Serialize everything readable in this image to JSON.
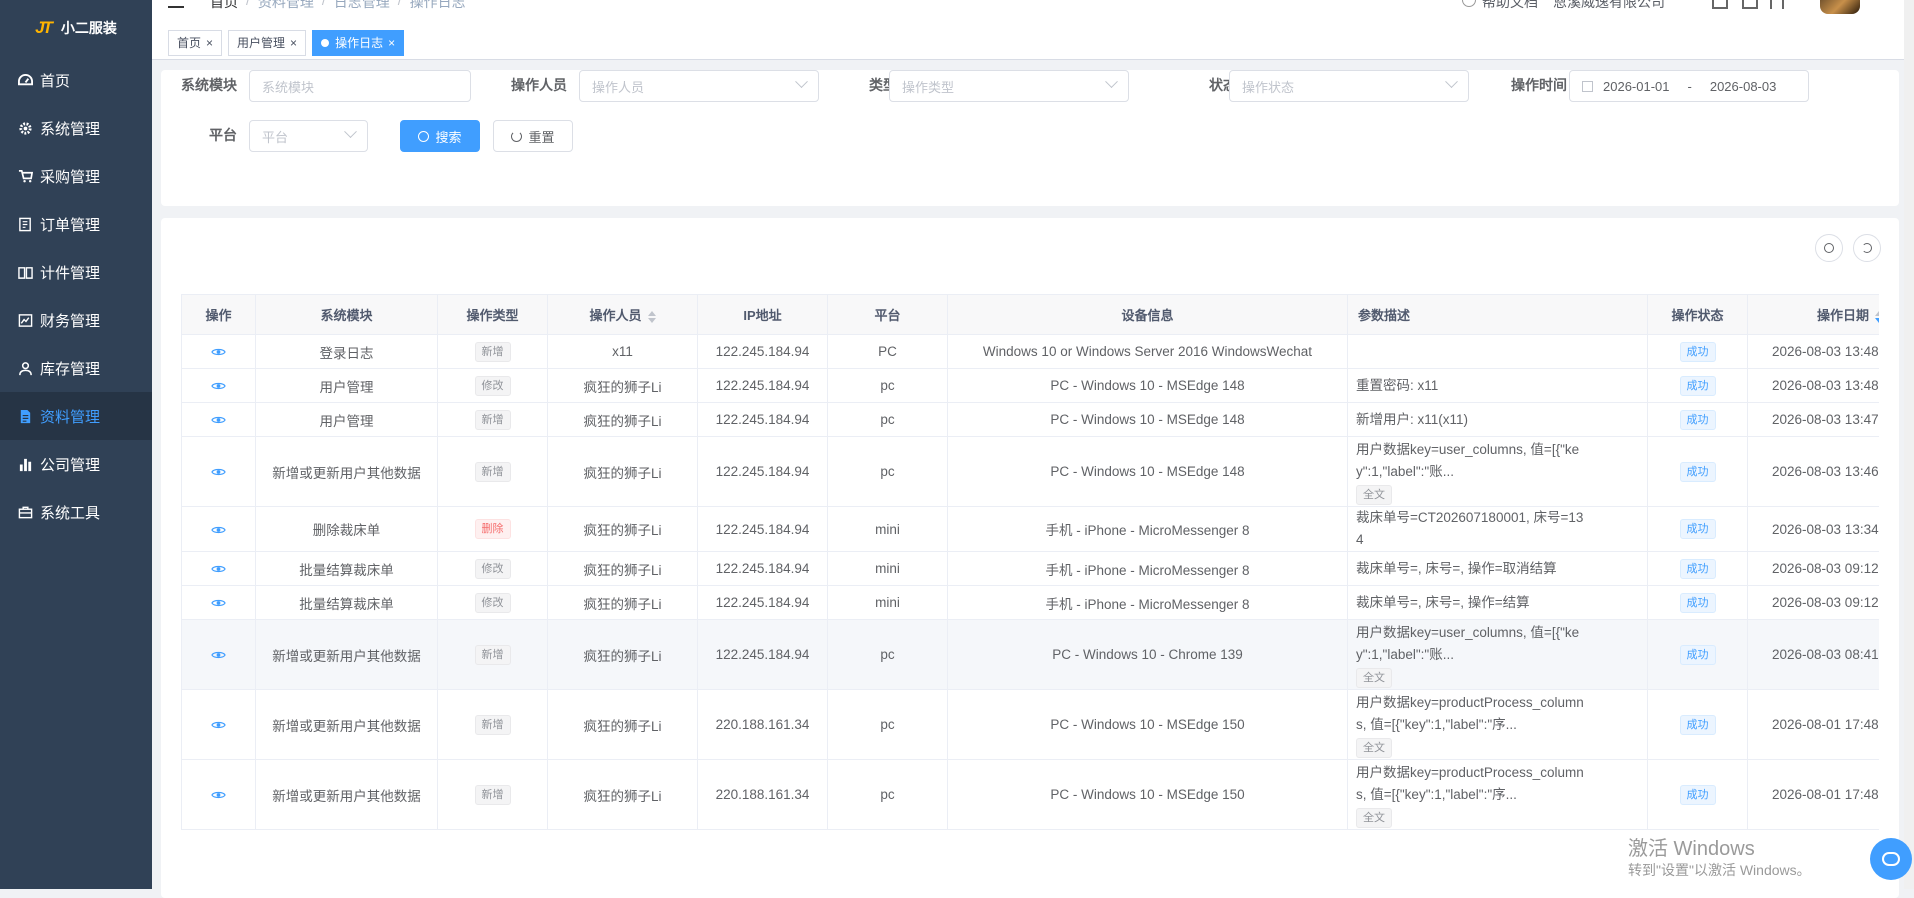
{
  "app": {
    "logo_mark": "JT",
    "title": "小二服装"
  },
  "sidebar": {
    "items": [
      {
        "label": "首页",
        "icon": "dashboard-icon"
      },
      {
        "label": "系统管理",
        "icon": "gear-icon"
      },
      {
        "label": "采购管理",
        "icon": "cart-icon"
      },
      {
        "label": "订单管理",
        "icon": "order-icon"
      },
      {
        "label": "计件管理",
        "icon": "book-icon"
      },
      {
        "label": "财务管理",
        "icon": "chart-icon"
      },
      {
        "label": "库存管理",
        "icon": "user-icon"
      },
      {
        "label": "资料管理",
        "icon": "document-icon",
        "active": true
      },
      {
        "label": "公司管理",
        "icon": "bar-chart-icon"
      },
      {
        "label": "系统工具",
        "icon": "toolbox-icon"
      }
    ]
  },
  "topbar": {
    "breadcrumb": [
      "首页",
      "资料管理",
      "日志管理",
      "操作日志"
    ],
    "help": "帮助文档",
    "company": "恩溪威逸有限公司"
  },
  "tags": [
    {
      "label": "首页"
    },
    {
      "label": "用户管理"
    },
    {
      "label": "操作日志",
      "active": true
    }
  ],
  "filter": {
    "module_label": "系统模块",
    "module_placeholder": "系统模块",
    "operator_label": "操作人员",
    "operator_placeholder": "操作人员",
    "type_label": "类型",
    "type_placeholder": "操作类型",
    "status_label": "状态",
    "status_placeholder": "操作状态",
    "time_label": "操作时间",
    "date_start": "2026-01-01",
    "date_sep": "-",
    "date_end": "2026-08-03",
    "platform_label": "平台",
    "platform_placeholder": "平台",
    "search_btn": "搜索",
    "reset_btn": "重置"
  },
  "table": {
    "headers": [
      "操作",
      "系统模块",
      "操作类型",
      "操作人员",
      "IP地址",
      "平台",
      "设备信息",
      "参数描述",
      "操作状态",
      "操作日期"
    ],
    "full_text_label": "全文",
    "rows": [
      {
        "module": "登录日志",
        "type": "新增",
        "type_style": "info",
        "operator": "x11",
        "ip": "122.245.184.94",
        "platform": "PC",
        "device": "Windows 10 or Windows Server 2016 WindowsWechat",
        "param": "",
        "full": false,
        "status": "成功",
        "date": "2026-08-03 13:48"
      },
      {
        "module": "用户管理",
        "type": "修改",
        "type_style": "info",
        "operator": "疯狂的狮子Li",
        "ip": "122.245.184.94",
        "platform": "pc",
        "device": "PC - Windows 10 - MSEdge 148",
        "param": "重置密码: x11",
        "full": false,
        "status": "成功",
        "date": "2026-08-03 13:48"
      },
      {
        "module": "用户管理",
        "type": "新增",
        "type_style": "info",
        "operator": "疯狂的狮子Li",
        "ip": "122.245.184.94",
        "platform": "pc",
        "device": "PC - Windows 10 - MSEdge 148",
        "param": "新增用户: x11(x11)",
        "full": false,
        "status": "成功",
        "date": "2026-08-03 13:47"
      },
      {
        "module": "新增或更新用户其他数据",
        "type": "新增",
        "type_style": "info",
        "operator": "疯狂的狮子Li",
        "ip": "122.245.184.94",
        "platform": "pc",
        "device": "PC - Windows 10 - MSEdge 148",
        "param": "用户数据key=user_columns, 值=[{\"key\":1,\"label\":\"账...",
        "full": true,
        "status": "成功",
        "date": "2026-08-03 13:46"
      },
      {
        "module": "删除裁床单",
        "type": "删除",
        "type_style": "danger",
        "operator": "疯狂的狮子Li",
        "ip": "122.245.184.94",
        "platform": "mini",
        "device": "手机 - iPhone - MicroMessenger 8",
        "param": "裁床单号=CT202607180001, 床号=134",
        "full": false,
        "status": "成功",
        "date": "2026-08-03 13:34"
      },
      {
        "module": "批量结算裁床单",
        "type": "修改",
        "type_style": "info",
        "operator": "疯狂的狮子Li",
        "ip": "122.245.184.94",
        "platform": "mini",
        "device": "手机 - iPhone - MicroMessenger 8",
        "param": "裁床单号=, 床号=, 操作=取消结算",
        "full": false,
        "status": "成功",
        "date": "2026-08-03 09:12"
      },
      {
        "module": "批量结算裁床单",
        "type": "修改",
        "type_style": "info",
        "operator": "疯狂的狮子Li",
        "ip": "122.245.184.94",
        "platform": "mini",
        "device": "手机 - iPhone - MicroMessenger 8",
        "param": "裁床单号=, 床号=, 操作=结算",
        "full": false,
        "status": "成功",
        "date": "2026-08-03 09:12"
      },
      {
        "module": "新增或更新用户其他数据",
        "type": "新增",
        "type_style": "info",
        "operator": "疯狂的狮子Li",
        "ip": "122.245.184.94",
        "platform": "pc",
        "device": "PC - Windows 10 - Chrome 139",
        "param": "用户数据key=user_columns, 值=[{\"key\":1,\"label\":\"账...",
        "full": true,
        "status": "成功",
        "date": "2026-08-03 08:41",
        "highlight": true
      },
      {
        "module": "新增或更新用户其他数据",
        "type": "新增",
        "type_style": "info",
        "operator": "疯狂的狮子Li",
        "ip": "220.188.161.34",
        "platform": "pc",
        "device": "PC - Windows 10 - MSEdge 150",
        "param": "用户数据key=productProcess_columns, 值=[{\"key\":1,\"label\":\"序...",
        "full": true,
        "status": "成功",
        "date": "2026-08-01 17:48"
      },
      {
        "module": "新增或更新用户其他数据",
        "type": "新增",
        "type_style": "info",
        "operator": "疯狂的狮子Li",
        "ip": "220.188.161.34",
        "platform": "pc",
        "device": "PC - Windows 10 - MSEdge 150",
        "param": "用户数据key=productProcess_columns, 值=[{\"key\":1,\"label\":\"序...",
        "full": true,
        "status": "成功",
        "date": "2026-08-01 17:48"
      }
    ]
  },
  "watermark": {
    "line1": "激活 Windows",
    "line2": "转到\"设置\"以激活 Windows。"
  },
  "colors": {
    "sidebar_bg": "#304156",
    "primary": "#409eff",
    "danger": "#f56c6c"
  }
}
